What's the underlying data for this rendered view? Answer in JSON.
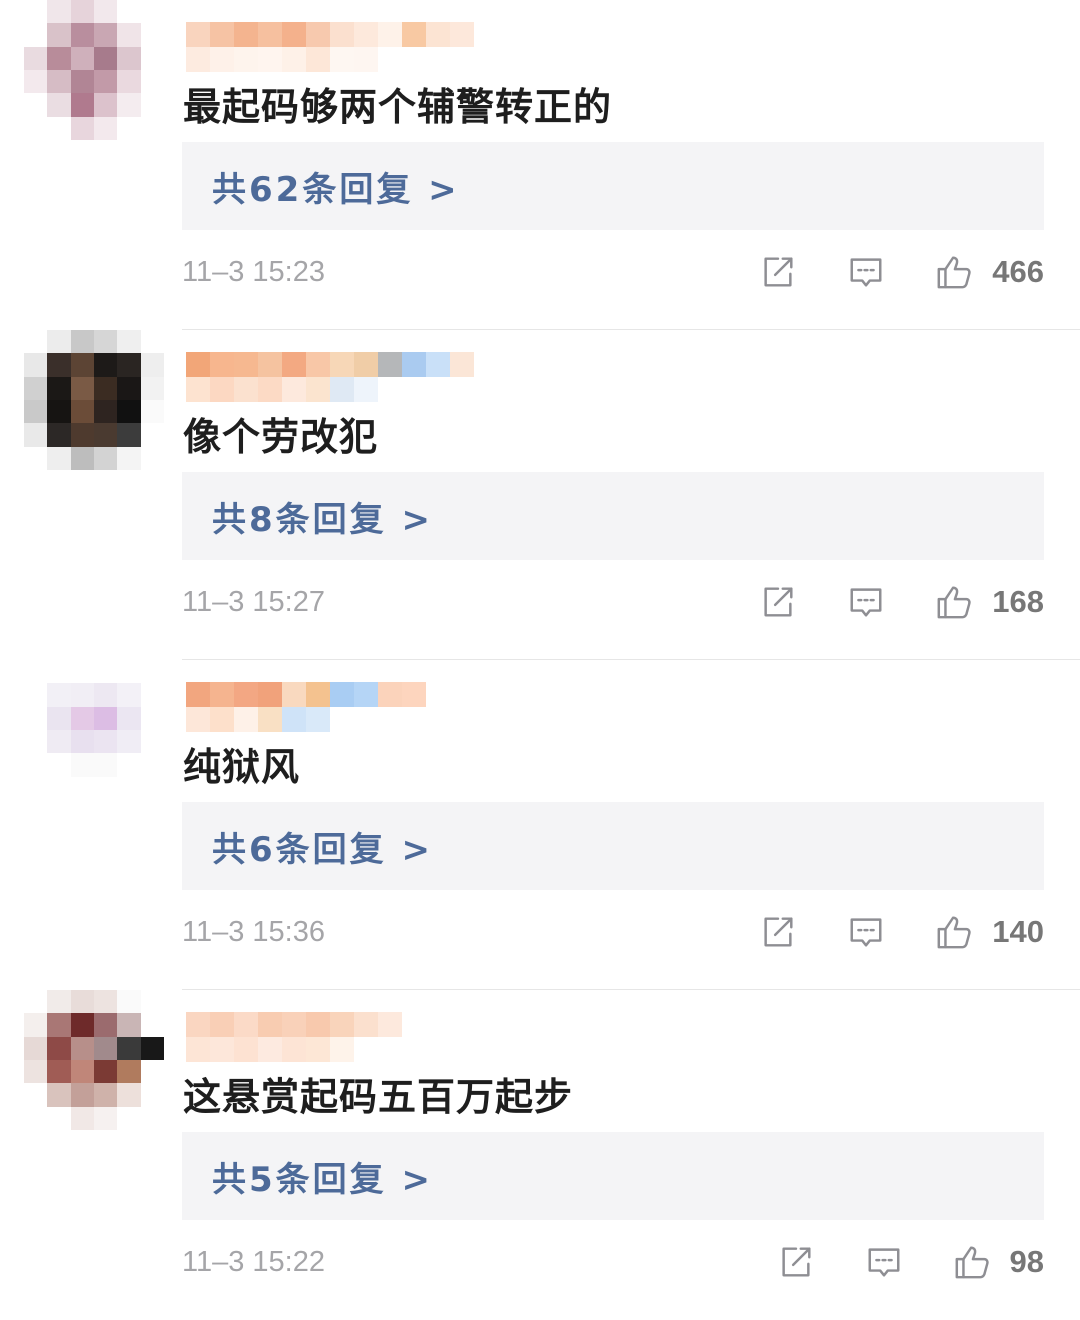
{
  "comments": [
    {
      "text": "最起码够两个辅警转正的",
      "replies_label": "共62条回复 >",
      "time": "11–3 15:23",
      "likes": "466",
      "avatar_colors": [
        "#fff",
        "#f0e6ea",
        "#e6d3da",
        "#f2e8ec",
        "#fff",
        "#fff",
        "#fff",
        "#d9c2c9",
        "#b98e9e",
        "#c9a7b3",
        "#f0e4e8",
        "#fff",
        "#e9dbe0",
        "#b88c9a",
        "#cfb0bb",
        "#a77b8c",
        "#dcc6ce",
        "#fff",
        "#f3e9ed",
        "#d6bcc5",
        "#b18595",
        "#c29aa8",
        "#ead9df",
        "#fff",
        "#fff",
        "#eadde2",
        "#b07a8e",
        "#dcc2cc",
        "#f4ecef",
        "#fff",
        "#fff",
        "#fff",
        "#e8d6dd",
        "#f3e9ed",
        "#fff",
        "#fff"
      ],
      "name_colors": [
        "#f9d4be",
        "#f6c3a4",
        "#f4b48f",
        "#f6c09f",
        "#f4b18c",
        "#f7c9ae",
        "#fbe0cf",
        "#fde9dc",
        "#fef2e9",
        "#f8c9a3",
        "#fce4d3",
        "#fde8db",
        "#fdebe0",
        "#fef1e9",
        "#fef4ed",
        "#fff5ef",
        "#fef1e8",
        "#fde7d8",
        "#fef7f2",
        "#fef6f1"
      ]
    },
    {
      "text": "像个劳改犯",
      "replies_label": "共8条回复 >",
      "time": "11–3 15:27",
      "likes": "168",
      "avatar_colors": [
        "#fff",
        "#ececec",
        "#c8c8c8",
        "#d6d6d6",
        "#efefef",
        "#fff",
        "#e8e8e8",
        "#3a2f2a",
        "#5c4434",
        "#1d1a18",
        "#2a2522",
        "#eeeeee",
        "#d0d0d0",
        "#1b1816",
        "#7a5a45",
        "#3b2c22",
        "#1a1716",
        "#f2f2f2",
        "#c9c9c9",
        "#161412",
        "#6b4c38",
        "#2e2420",
        "#111111",
        "#fafafa",
        "#e9e9e9",
        "#2c2826",
        "#4e3a2e",
        "#4a3a30",
        "#3c3c3c",
        "#fff",
        "#fff",
        "#eeeeee",
        "#bdbdbd",
        "#d3d3d3",
        "#f4f4f4",
        "#fff"
      ],
      "name_colors": [
        "#f2a678",
        "#f7b68e",
        "#f6b890",
        "#f5c3a0",
        "#f3a982",
        "#f8c7a7",
        "#f7d7b7",
        "#f0cda7",
        "#b5b7b9",
        "#aacbf0",
        "#c9e0f8",
        "#fbe6d7",
        "#fde3d0",
        "#fcd8c2",
        "#fbe1cf",
        "#fcdac5",
        "#fde9dd",
        "#fbe4cf",
        "#dfe9f4",
        "#eef4fb"
      ]
    },
    {
      "text": "纯狱风",
      "replies_label": "共6条回复 >",
      "time": "11–3 15:36",
      "likes": "140",
      "avatar_colors": [
        "#fff",
        "#fff",
        "#fff",
        "#fff",
        "#fff",
        "#fff",
        "#fff",
        "#f2f0f6",
        "#f1eef5",
        "#ede8f2",
        "#f3f1f7",
        "#fff",
        "#fff",
        "#eae4f0",
        "#e4c9e6",
        "#dcbde4",
        "#ebe6f2",
        "#fff",
        "#fff",
        "#efebf3",
        "#e8e0ef",
        "#ebe4f1",
        "#f0edf5",
        "#fff",
        "#fff",
        "#fff",
        "#fafafa",
        "#fafafa",
        "#fff",
        "#fff",
        "#fff",
        "#fff",
        "#fff",
        "#fff",
        "#fff",
        "#fff"
      ],
      "name_colors": [
        "#f2a67f",
        "#f5b48f",
        "#f3a783",
        "#f1a27b",
        "#f9d9bf",
        "#f4c28f",
        "#a9cdf3",
        "#b5d5f6",
        "#fbd3bb",
        "#fdd5be",
        "#fde7d9",
        "#fde0cb",
        "#fef1e8",
        "#f9e0c4",
        "#cfe3f8",
        "#d9e9f9"
      ]
    },
    {
      "text": "这悬赏起码五百万起步",
      "replies_label": "共5条回复 >",
      "time": "11–3 15:22",
      "likes": "98",
      "avatar_colors": [
        "#fff",
        "#f1ebe9",
        "#e8dcd9",
        "#ede3e0",
        "#fafafa",
        "#fff",
        "#f4efed",
        "#a97775",
        "#6e2a2a",
        "#9b6b6e",
        "#c9b5b5",
        "#fff",
        "#e6d9d6",
        "#8e4a47",
        "#b78f8a",
        "#a18a8c",
        "#3a3a3a",
        "#181818",
        "#ede3e0",
        "#a05c55",
        "#c08679",
        "#7b3a34",
        "#b07b5e",
        "#fff",
        "#fff",
        "#d9c3bd",
        "#c3a099",
        "#cfb2aa",
        "#ede0db",
        "#fff",
        "#fff",
        "#fff",
        "#f1e8e6",
        "#f6f1f0",
        "#fff",
        "#fff"
      ],
      "name_colors": [
        "#fad6c1",
        "#f9cfb6",
        "#fbdac7",
        "#f8ccb1",
        "#f9d1b9",
        "#f8c9ad",
        "#f9d4bb",
        "#fbe0ce",
        "#fde9dd",
        "#fde5d6",
        "#fde7da",
        "#fde2d2",
        "#fdeae0",
        "#fde4d5",
        "#fde7d6",
        "#fef3ea"
      ]
    }
  ]
}
